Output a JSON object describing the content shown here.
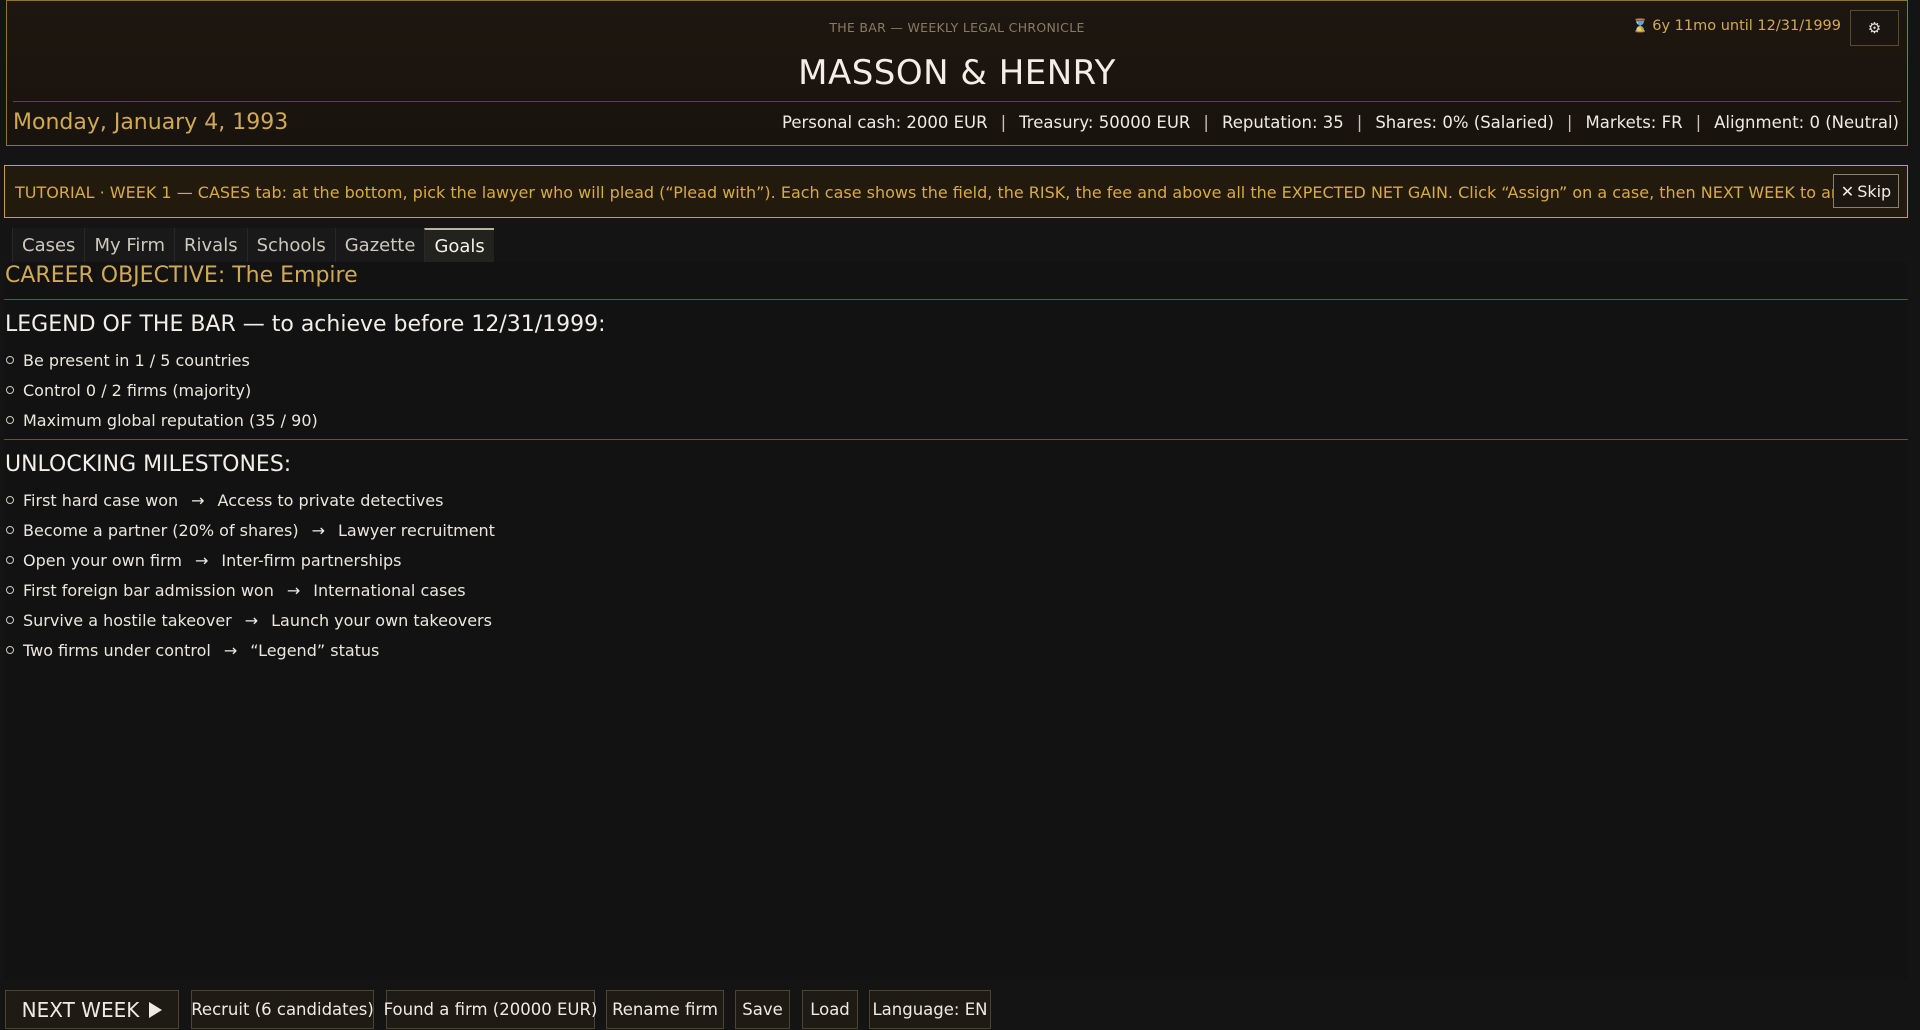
{
  "header": {
    "chronicle": "THE BAR  —  WEEKLY LEGAL CHRONICLE",
    "firm_name": "MASSON & HENRY",
    "countdown": "6y 11mo until 12/31/1999",
    "date": "Monday, January 4, 1993",
    "stats": {
      "personal_cash": "Personal cash: 2000 EUR",
      "treasury": "Treasury: 50000 EUR",
      "reputation": "Reputation: 35",
      "shares": "Shares: 0% (Salaried)",
      "markets": "Markets: FR",
      "alignment": "Alignment: 0 (Neutral)"
    },
    "separator": "|"
  },
  "tutorial": {
    "text": "TUTORIAL · WEEK 1 — CASES tab: at the bottom, pick the lawyer who will plead (“Plead with”). Each case shows the field, the RISK, the fee and above all the EXPECTED NET GAIN. Click “Assign” on a case, then NEXT WEEK to argue it.",
    "skip_label": "Skip"
  },
  "tabs": [
    {
      "label": "Cases"
    },
    {
      "label": "My Firm"
    },
    {
      "label": "Rivals"
    },
    {
      "label": "Schools"
    },
    {
      "label": "Gazette"
    },
    {
      "label": "Goals",
      "active": true
    }
  ],
  "goals": {
    "objective": "CAREER OBJECTIVE:  The Empire",
    "legend_title": "LEGEND OF THE BAR — to achieve before 12/31/1999:",
    "legend_items": [
      "Be present in 1 / 5 countries",
      "Control 0 / 2 firms (majority)",
      "Maximum global reputation (35 / 90)"
    ],
    "milestones_title": "UNLOCKING MILESTONES:",
    "milestones": [
      {
        "condition": "First hard case won",
        "unlock": "Access to private detectives"
      },
      {
        "condition": "Become a partner (20% of shares)",
        "unlock": "Lawyer recruitment"
      },
      {
        "condition": "Open your own firm",
        "unlock": "Inter-firm partnerships"
      },
      {
        "condition": "First foreign bar admission won",
        "unlock": "International cases"
      },
      {
        "condition": "Survive a hostile takeover",
        "unlock": "Launch your own takeovers"
      },
      {
        "condition": "Two firms under control",
        "unlock": "“Legend” status"
      }
    ],
    "arrow": "→"
  },
  "footer": {
    "next_week": "NEXT WEEK",
    "recruit": "Recruit (6 candidates)",
    "found_firm": "Found a firm (20000 EUR)",
    "rename": "Rename firm",
    "save": "Save",
    "load": "Load",
    "language": "Language: EN"
  },
  "colors": {
    "accent_gold": "#d2a953",
    "border_gold": "#c9a240",
    "background": "#141414"
  },
  "icons": {
    "countdown": "hourglass-icon",
    "settings": "gear-icon",
    "skip": "close-icon",
    "next_week": "play-icon"
  }
}
